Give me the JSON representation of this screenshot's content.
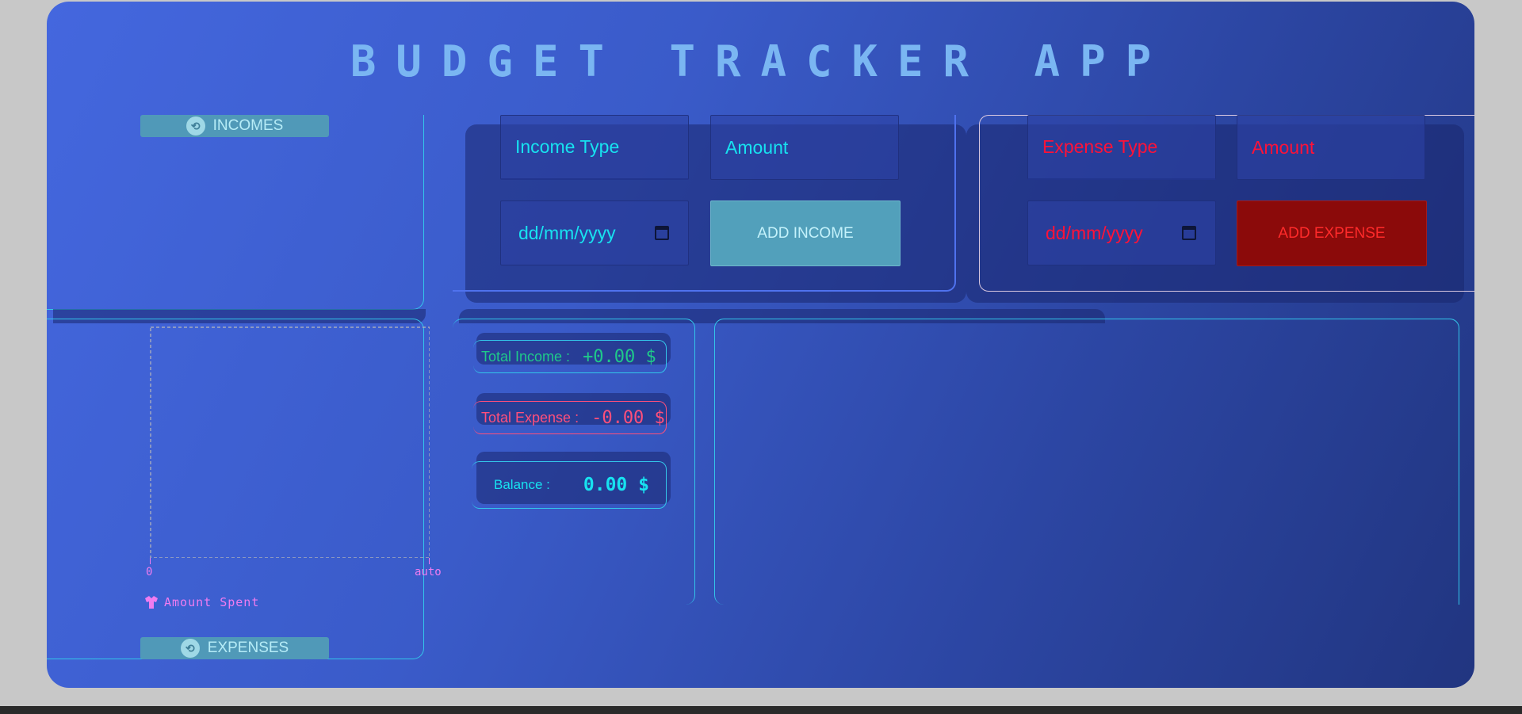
{
  "app": {
    "title": "BUDGET TRACKER APP"
  },
  "incomes_panel": {
    "label": "INCOMES",
    "icon": "sync-icon"
  },
  "expenses_panel": {
    "label": "EXPENSES",
    "icon": "sync-icon"
  },
  "income_form": {
    "type_placeholder": "Income Type",
    "amount_placeholder": "Amount",
    "date_placeholder": "dd/mm/yyyy",
    "submit_label": "ADD INCOME"
  },
  "expense_form": {
    "type_placeholder": "Expense Type",
    "amount_placeholder": "Amount",
    "date_placeholder": "dd/mm/yyyy",
    "submit_label": "ADD EXPENSE"
  },
  "totals": {
    "income_label": "Total Income :",
    "income_value": "+0.00 $",
    "expense_label": "Total Expense :",
    "expense_value": "-0.00 $",
    "balance_label": "Balance :",
    "balance_value": "0.00 $"
  },
  "chart_data": {
    "type": "bar",
    "categories": [],
    "series": [],
    "x_tick_labels": [
      "0",
      "auto"
    ],
    "legend": [
      "Amount Spent"
    ],
    "legend_color": "#f07cf0",
    "legend_position": "bottom-left"
  },
  "colors": {
    "accent_cyan": "#17e2f0",
    "expense_red": "#ff1238",
    "income_green": "#1fc98a",
    "expense_pink": "#ff4f7b",
    "title": "#7ab6f2"
  }
}
